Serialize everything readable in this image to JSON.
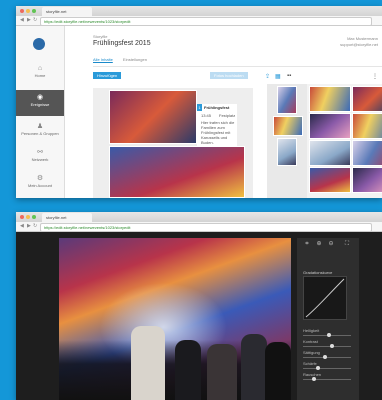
{
  "colors": {
    "background": "#1497d8",
    "accent": "#2a9ad9",
    "sidebar_active": "#555555"
  },
  "window1": {
    "tab_label": "storyfile.net",
    "url": "https://edit.storyfile.net/newevents/1023/storyedit",
    "sidebar": [
      {
        "icon": "home-icon",
        "label": "Home"
      },
      {
        "icon": "events-icon",
        "label": "Ereignisse",
        "active": true
      },
      {
        "icon": "people-icon",
        "label": "Personen & Gruppen"
      },
      {
        "icon": "network-icon",
        "label": "Netzwerk"
      },
      {
        "icon": "settings-icon",
        "label": "Mein Account"
      }
    ],
    "header": {
      "breadcrumb": "Storyfile",
      "title": "Frühlingsfest 2015",
      "user_line1": "Max Mustermann",
      "user_line2": "support@storyfile.net"
    },
    "tabs": [
      "Alle Inhalte",
      "Einstellungen"
    ],
    "buttons": {
      "add": "Hinzufügen",
      "upload": "Fotos hochladen"
    },
    "caption": {
      "number": "1",
      "title": "Frühlingsfest",
      "line1": "13:45",
      "line2": "Festplatz",
      "body": "Hier trafen sich die Familien zum Frühlingsfest mit Karussells und Buden."
    }
  },
  "window2": {
    "tab_label": "storyfile.net",
    "url": "https://edit.storyfile.net/newevents/1023/storyedit",
    "panel": {
      "curve_label": "Gradationskurve",
      "sliders": [
        {
          "label": "Helligkeit",
          "value": 0.55
        },
        {
          "label": "Kontrast",
          "value": 0.62
        },
        {
          "label": "Sättigung",
          "value": 0.45
        },
        {
          "label": "Schärfe",
          "value": 0.3
        },
        {
          "label": "Rauschen",
          "value": 0.2
        }
      ]
    }
  }
}
